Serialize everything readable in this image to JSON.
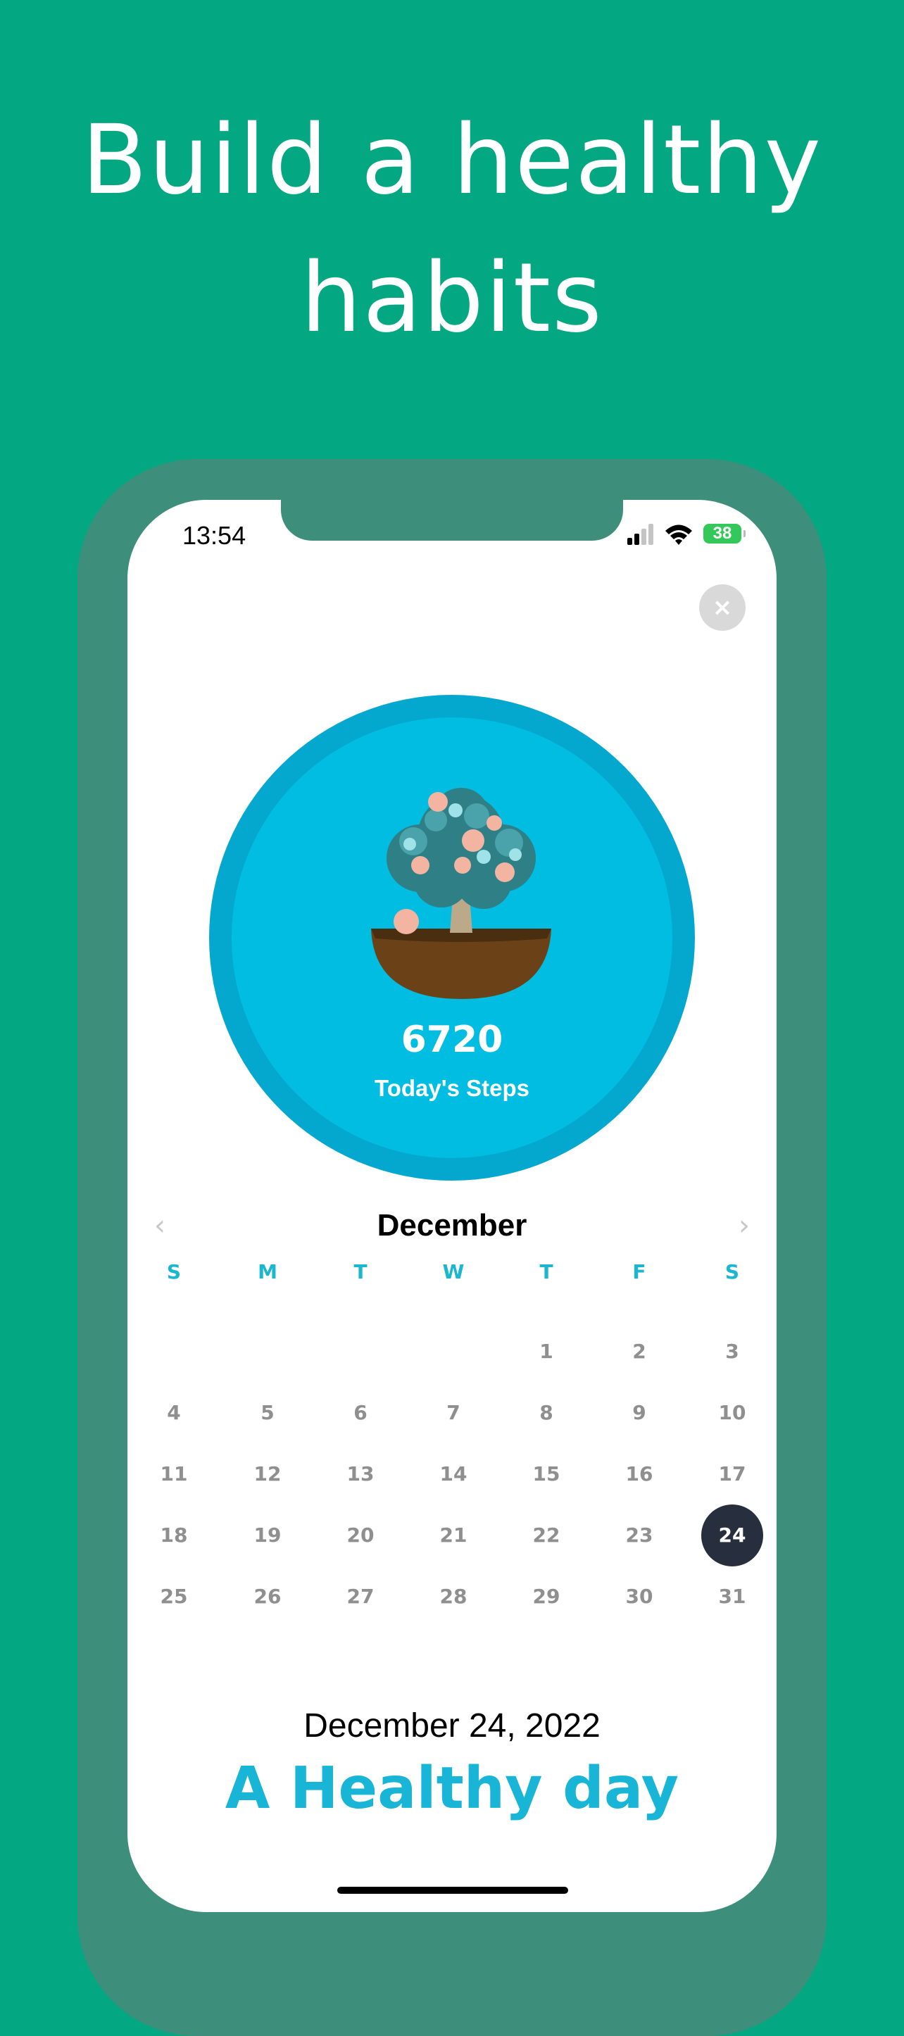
{
  "headline": {
    "line1": "Build a healthy",
    "line2": "habits"
  },
  "status_bar": {
    "time": "13:54",
    "battery": "38"
  },
  "close_button": {
    "label": "×"
  },
  "steps": {
    "count": "6720",
    "label": "Today's Steps"
  },
  "calendar": {
    "month": "December",
    "prev_label": "‹",
    "next_label": "›",
    "weekdays": [
      "S",
      "M",
      "T",
      "W",
      "T",
      "F",
      "S"
    ],
    "first_weekday_index": 4,
    "days_in_month": 31,
    "selected_day": 24
  },
  "summary": {
    "date": "December 24, 2022",
    "quality": "A Healthy day"
  },
  "colors": {
    "background": "#03a781",
    "frame": "#3d8f7c",
    "ring": "#04a8ce",
    "circle": "#00bde1",
    "accent": "#18b5d6",
    "selected_day": "#272f3f"
  }
}
